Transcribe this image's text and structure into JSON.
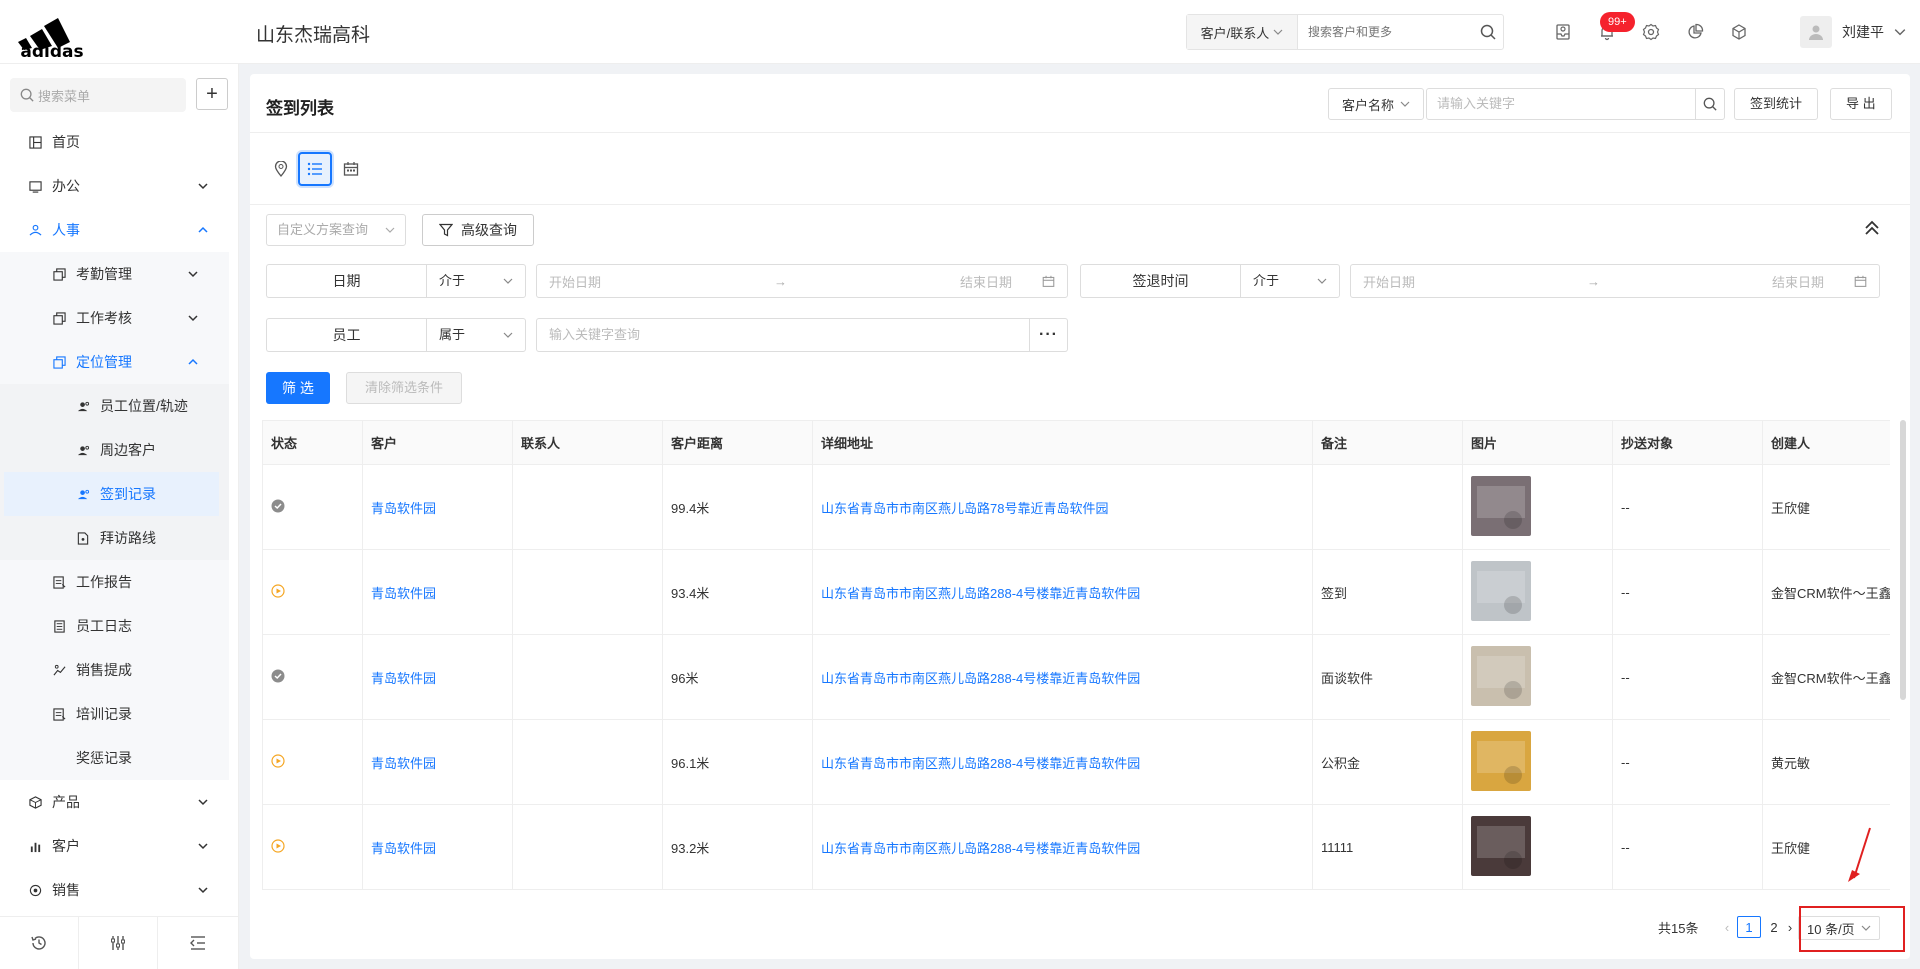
{
  "header": {
    "logo_text": "adidas",
    "company": "山东杰瑞高科",
    "search_scope": "客户/联系人",
    "search_placeholder": "搜索客户和更多",
    "notif_badge": "99+",
    "user_name": "刘建平"
  },
  "sidebar": {
    "search_placeholder": "搜索菜单",
    "add_label": "+",
    "items": [
      {
        "label": "首页"
      },
      {
        "label": "办公"
      },
      {
        "label": "人事"
      },
      {
        "label": "考勤管理"
      },
      {
        "label": "工作考核"
      },
      {
        "label": "定位管理"
      },
      {
        "label": "员工位置/轨迹"
      },
      {
        "label": "周边客户"
      },
      {
        "label": "签到记录"
      },
      {
        "label": "拜访路线"
      },
      {
        "label": "工作报告"
      },
      {
        "label": "员工日志"
      },
      {
        "label": "销售提成"
      },
      {
        "label": "培训记录"
      },
      {
        "label": "奖惩记录"
      },
      {
        "label": "产品"
      },
      {
        "label": "客户"
      },
      {
        "label": "销售"
      }
    ]
  },
  "page": {
    "title": "签到列表",
    "search_field": "客户名称",
    "search_placeholder": "请输入关键字",
    "stats_button": "签到统计",
    "export_button": "导 出"
  },
  "filters": {
    "scheme_placeholder": "自定义方案查询",
    "advanced": "高级查询",
    "date_label": "日期",
    "date_op": "介于",
    "date_start": "开始日期",
    "date_end": "结束日期",
    "checkout_label": "签退时间",
    "checkout_op": "介于",
    "checkout_start": "开始日期",
    "checkout_end": "结束日期",
    "employee_label": "员工",
    "employee_op": "属于",
    "employee_placeholder": "输入关键字查询",
    "filter_button": "筛 选",
    "clear_button": "清除筛选条件"
  },
  "table": {
    "columns": [
      "状态",
      "客户",
      "联系人",
      "客户距离",
      "详细地址",
      "备注",
      "图片",
      "抄送对象",
      "创建人"
    ],
    "rows": [
      {
        "status": "done",
        "customer": "青岛软件园",
        "contact": "",
        "distance": "99.4米",
        "address": "山东省青岛市市南区燕儿岛路78号靠近青岛软件园",
        "note": "",
        "cc": "--",
        "creator": "王欣健",
        "img_color": "#7a6f74"
      },
      {
        "status": "pending",
        "customer": "青岛软件园",
        "contact": "",
        "distance": "93.4米",
        "address": "山东省青岛市市南区燕儿岛路288-4号楼靠近青岛软件园",
        "note": "签到",
        "cc": "--",
        "creator": "金智CRM软件～王鑫",
        "img_color": "#bfc4c8"
      },
      {
        "status": "done",
        "customer": "青岛软件园",
        "contact": "",
        "distance": "96米",
        "address": "山东省青岛市市南区燕儿岛路288-4号楼靠近青岛软件园",
        "note": "面谈软件",
        "cc": "--",
        "creator": "金智CRM软件～王鑫",
        "img_color": "#c9bfae"
      },
      {
        "status": "pending",
        "customer": "青岛软件园",
        "contact": "",
        "distance": "96.1米",
        "address": "山东省青岛市市南区燕儿岛路288-4号楼靠近青岛软件园",
        "note": "公积金",
        "cc": "--",
        "creator": "黄元敏",
        "img_color": "#d9a640"
      },
      {
        "status": "pending",
        "customer": "青岛软件园",
        "contact": "",
        "distance": "93.2米",
        "address": "山东省青岛市市南区燕儿岛路288-4号楼靠近青岛软件园",
        "note": "11111",
        "cc": "--",
        "creator": "王欣健",
        "img_color": "#4a3a3a"
      }
    ]
  },
  "pagination": {
    "total": "共15条",
    "page1": "1",
    "page2": "2",
    "page_size": "10 条/页"
  },
  "colors": {
    "accent": "#1677ff",
    "danger": "#f5222d",
    "pending": "#f5a623",
    "done": "#8c8c8c"
  }
}
